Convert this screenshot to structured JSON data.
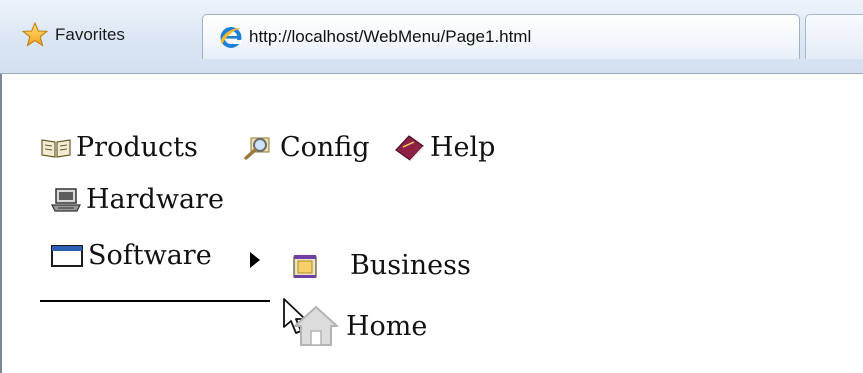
{
  "browser": {
    "favorites_label": "Favorites",
    "tab_title": "http://localhost/WebMenu/Page1.html"
  },
  "menu": {
    "top_items": [
      {
        "label": "Products",
        "icon": "book-icon"
      },
      {
        "label": "Config",
        "icon": "magnifier-icon"
      },
      {
        "label": "Help",
        "icon": "help-book-icon"
      }
    ],
    "submenu_items": [
      {
        "label": "Hardware",
        "icon": "computer-icon"
      },
      {
        "label": "Software",
        "icon": "window-icon",
        "has_submenu": true
      }
    ],
    "flyout_items": [
      {
        "label": "Business",
        "icon": "briefcase-icon"
      },
      {
        "label": "Home",
        "icon": "house-icon"
      }
    ]
  }
}
